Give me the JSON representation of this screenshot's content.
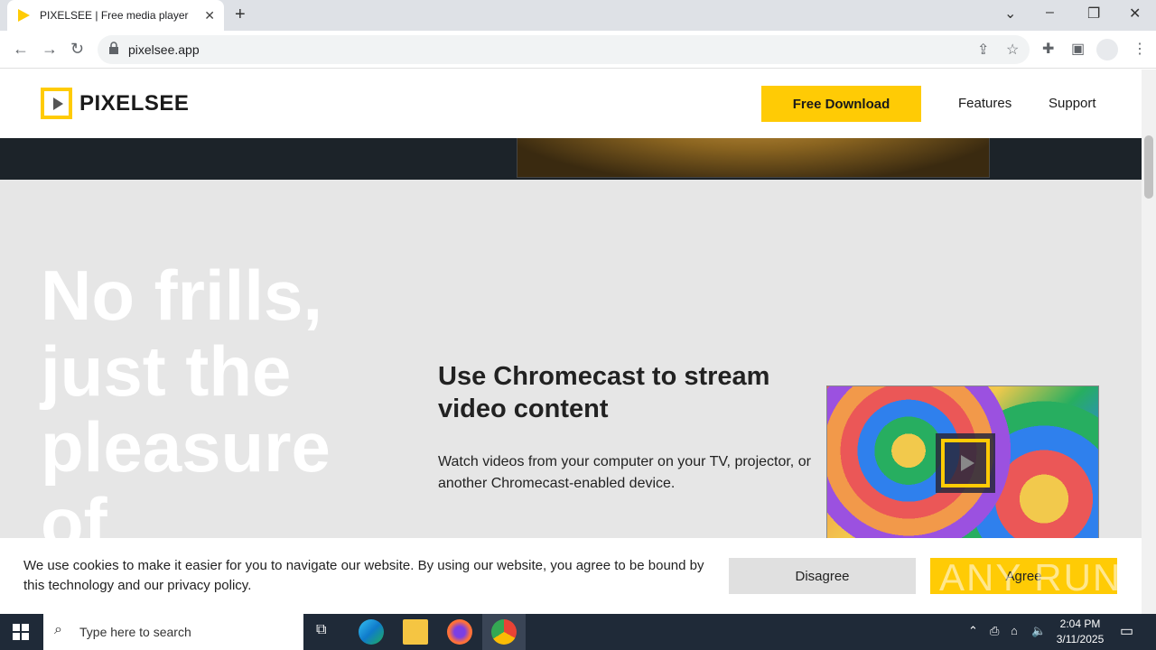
{
  "browser": {
    "tab_title": "PIXELSEE | Free media player for",
    "url": "pixelsee.app",
    "icons": [
      "back-icon",
      "forward-icon",
      "reload-icon",
      "lock-icon",
      "share-icon",
      "star-icon",
      "extensions-icon",
      "sidepanel-icon",
      "profile-icon",
      "menu-icon"
    ]
  },
  "site": {
    "logo_text": "PIXELSEE",
    "nav": {
      "download": "Free Download",
      "features": "Features",
      "support": "Support"
    },
    "hero_text": "No frills,\njust the\npleasure\nof",
    "feature": {
      "title": "Use Chromecast to stream video content",
      "description": "Watch videos from your computer on your TV, projector, or another Chromecast-enabled device."
    },
    "cookie": {
      "text": "We use cookies to make it easier for you to navigate our website. By using our website, you agree to be bound by this technology and our privacy policy.",
      "disagree": "Disagree",
      "agree": "Agree"
    },
    "watermark": "ANY RUN"
  },
  "taskbar": {
    "search_placeholder": "Type here to search",
    "time": "2:04 PM",
    "date": "3/11/2025"
  },
  "colors": {
    "accent": "#ffcb05",
    "section_bg": "#e6e6e6",
    "hero_dark": "#1c2329",
    "taskbar": "#1f2a38"
  }
}
